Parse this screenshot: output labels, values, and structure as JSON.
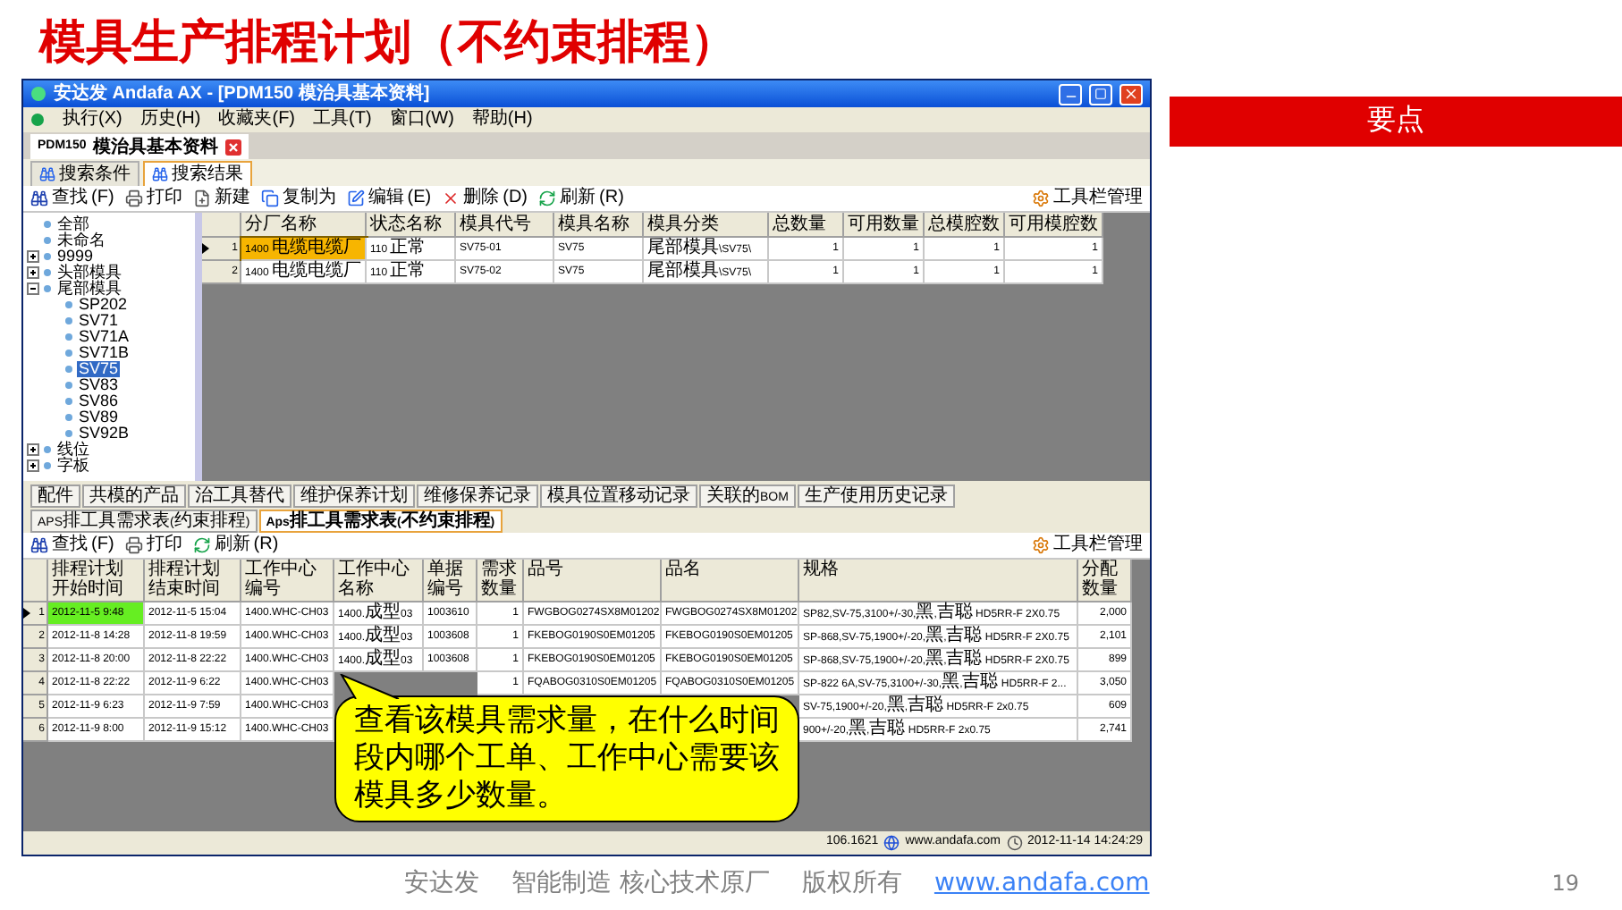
{
  "slide_title": "模具生产排程计划（不约束排程）",
  "window": {
    "title": "安达发 Andafa AX - [PDM150 模治具基本资料]"
  },
  "menu": [
    "执行(X)",
    "历史(H)",
    "收藏夹(F)",
    "工具(T)",
    "窗口(W)",
    "帮助(H)"
  ],
  "document_tab": {
    "label": "PDM150 模治具基本资料"
  },
  "search_tabs": [
    {
      "label": "搜索条件",
      "selected": false
    },
    {
      "label": "搜索结果",
      "selected": true
    }
  ],
  "toolbar": {
    "buttons": [
      "查找(F)",
      "打印",
      "新建",
      "复制为",
      "编辑(E)",
      "删除(D)",
      "刷新(R)"
    ],
    "manage": "工具栏管理"
  },
  "tree": [
    {
      "label": "全部",
      "selected": false
    },
    {
      "label": "未命名",
      "selected": false
    },
    {
      "label": "9999",
      "selected": false,
      "expanded": false
    },
    {
      "label": "头部模具",
      "selected": false,
      "expanded": false
    },
    {
      "label": "尾部模具",
      "selected": false,
      "expanded": true,
      "children": [
        {
          "label": "SP202",
          "selected": false
        },
        {
          "label": "SV71",
          "selected": false
        },
        {
          "label": "SV71A",
          "selected": false
        },
        {
          "label": "SV71B",
          "selected": false
        },
        {
          "label": "SV75",
          "selected": true
        },
        {
          "label": "SV83",
          "selected": false
        },
        {
          "label": "SV86",
          "selected": false
        },
        {
          "label": "SV89",
          "selected": false
        },
        {
          "label": "SV92B",
          "selected": false
        }
      ]
    },
    {
      "label": "线位",
      "selected": false,
      "expanded": false
    },
    {
      "label": "字板",
      "selected": false,
      "expanded": false
    }
  ],
  "mold_table": {
    "columns": [
      "分厂名称",
      "状态名称",
      "模具代号",
      "模具名称",
      "模具分类",
      "总数量",
      "可用数量",
      "总模腔数",
      "可用模腔数"
    ],
    "rows": [
      {
        "number": "1",
        "selected": true,
        "cells": [
          "1400 电缆电缆厂",
          "110 正常",
          "SV75-01",
          "SV75",
          "尾部模具\\SV75\\",
          "1",
          "1",
          "1",
          "1"
        ]
      },
      {
        "number": "2",
        "selected": false,
        "cells": [
          "1400 电缆电缆厂",
          "110 正常",
          "SV75-02",
          "SV75",
          "尾部模具\\SV75\\",
          "1",
          "1",
          "1",
          "1"
        ]
      }
    ]
  },
  "detail_tabs": [
    {
      "label": "配件",
      "selected": false
    },
    {
      "label": "共模的产品",
      "selected": false
    },
    {
      "label": "治工具替代",
      "selected": false
    },
    {
      "label": "维护保养计划",
      "selected": false
    },
    {
      "label": "维修保养记录",
      "selected": false
    },
    {
      "label": "模具位置移动记录",
      "selected": false
    },
    {
      "label": "关联的BOM",
      "selected": false
    },
    {
      "label": "生产使用历史记录",
      "selected": false
    },
    {
      "label": "APS排工具需求表(约束排程)",
      "selected": false
    },
    {
      "label": "Aps排工具需求表(不约束排程)",
      "selected": true
    }
  ],
  "detail_toolbar": {
    "buttons": [
      "查找(F)",
      "打印",
      "刷新(R)"
    ],
    "manage": "工具栏管理"
  },
  "demand_table": {
    "columns": [
      "排程计划开始时间",
      "排程计划结束时间",
      "工作中心编号",
      "工作中心名称",
      "单据编号",
      "需求数量",
      "品号",
      "品名",
      "规格",
      "分配数量"
    ],
    "rows": [
      {
        "number": "1",
        "selected": true,
        "cells": [
          "2012-11-5 9:48",
          "2012-11-5 15:04",
          "1400.WHC-CH03",
          "1400.成型03",
          "1003610",
          "1",
          "FWGBOG0274SX8M01202",
          "FWGBOG0274SX8M01202",
          "SP82,SV-75,3100+/-30,黑,吉聪 HD5RR-F 2X0.75",
          "2,000"
        ]
      },
      {
        "number": "2",
        "selected": false,
        "cells": [
          "2012-11-8 14:28",
          "2012-11-8 19:59",
          "1400.WHC-CH03",
          "1400.成型03",
          "1003608",
          "1",
          "FKEBOG0190S0EM01205",
          "FKEBOG0190S0EM01205",
          "SP-868,SV-75,1900+/-20,黑,吉聪 HD5RR-F 2X0.75",
          "2,101"
        ]
      },
      {
        "number": "3",
        "selected": false,
        "cells": [
          "2012-11-8 20:00",
          "2012-11-8 22:22",
          "1400.WHC-CH03",
          "1400.成型03",
          "1003608",
          "1",
          "FKEBOG0190S0EM01205",
          "FKEBOG0190S0EM01205",
          "SP-868,SV-75,1900+/-20,黑,吉聪 HD5RR-F 2X0.75",
          "899"
        ]
      },
      {
        "number": "4",
        "selected": false,
        "cells": [
          "2012-11-8 22:22",
          "2012-11-9 6:22",
          "1400.WHC-CH03",
          null,
          null,
          "1",
          "FQABOG0310S0EM01205",
          "FQABOG0310S0EM01205",
          "SP-822 6A,SV-75,3100+/-30,黑,吉聪 HD5RR-F 2...",
          "3,050"
        ]
      },
      {
        "number": "5",
        "selected": false,
        "cells": [
          "2012-11-9 6:23",
          "2012-11-9 7:59",
          "1400.WHC-CH03",
          null,
          null,
          null,
          null,
          null,
          "SV-75,1900+/-20,黑,吉聪 HD5RR-F 2x0.75",
          "609"
        ]
      },
      {
        "number": "6",
        "selected": false,
        "cells": [
          "2012-11-9 8:00",
          "2012-11-9 15:12",
          "1400.WHC-CH03",
          null,
          null,
          null,
          null,
          null,
          "900+/-20,黑,吉聪 HD5RR-F 2x0.75",
          "2,741"
        ]
      }
    ]
  },
  "callout": "查看该模具需求量，在什么时间段内哪个工单、工作中心需要该模具多少数量。",
  "status_bar": {
    "version": "106.1621",
    "website": "www.andafa.com",
    "datetime": "2012-11-14 14:24:29"
  },
  "key_points": {
    "title": "要点"
  },
  "footer": {
    "company": "安达发",
    "slogan": "智能制造 核心技术原厂",
    "rights": "版权所有",
    "link": "www.andafa.com",
    "page": "19"
  }
}
